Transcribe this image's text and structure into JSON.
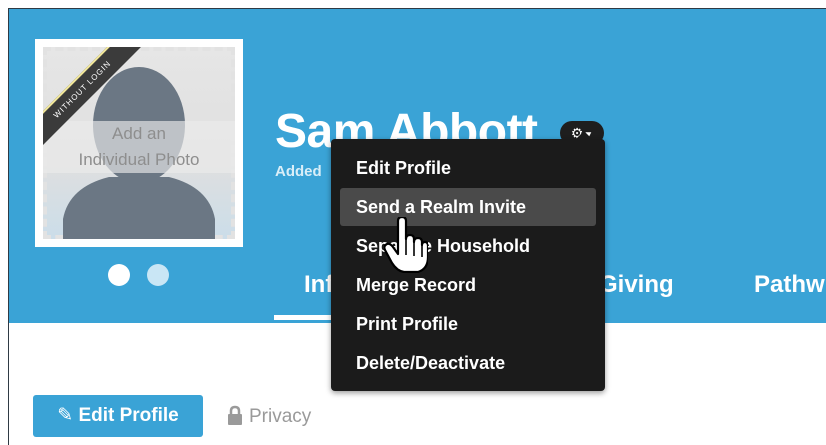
{
  "profile": {
    "name": "Sam Abbott",
    "added_prefix": "Added",
    "photo_prompt_line1": "Add an",
    "photo_prompt_line2": "Individual Photo",
    "ribbon_label": "WITHOUT LOGIN"
  },
  "tabs": [
    {
      "label": "Info"
    },
    {
      "label": "Giving"
    },
    {
      "label": "Pathw"
    }
  ],
  "settings_menu": {
    "items": [
      {
        "label": "Edit Profile"
      },
      {
        "label": "Send a Realm Invite",
        "hovered": true
      },
      {
        "label": "Separate Household"
      },
      {
        "label": "Merge Record"
      },
      {
        "label": "Print Profile"
      },
      {
        "label": "Delete/Deactivate"
      }
    ]
  },
  "actions": {
    "edit_profile": "Edit Profile",
    "privacy": "Privacy"
  },
  "colors": {
    "header_blue": "#3aa3d6",
    "menu_bg": "#1b1b1b",
    "menu_hover": "#4a4a4a"
  },
  "icons": [
    "gear-icon",
    "caret-down-icon",
    "pencil-icon",
    "lock-icon",
    "hand-cursor-icon"
  ]
}
